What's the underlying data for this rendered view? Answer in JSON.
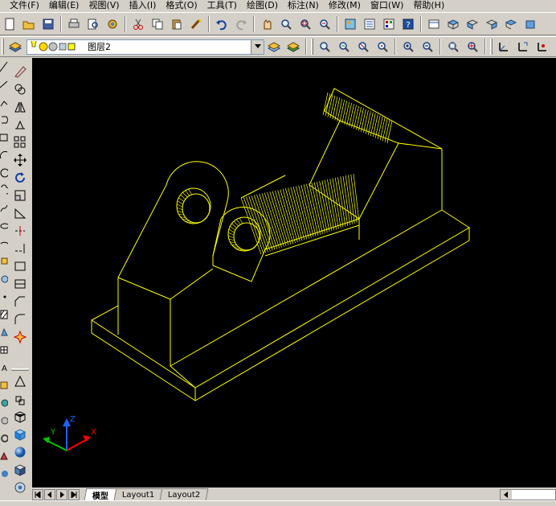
{
  "menu": {
    "items": [
      "文件(F)",
      "编辑(E)",
      "视图(V)",
      "插入(I)",
      "格式(O)",
      "工具(T)",
      "绘图(D)",
      "标注(N)",
      "修改(M)",
      "窗口(W)",
      "帮助(H)"
    ]
  },
  "layer_toolbar": {
    "current_layer": "图层2"
  },
  "viewport": {
    "background": "#000000",
    "line_color": "#ffff00",
    "ucs": {
      "x_label": "X",
      "y_label": "Y",
      "z_label": "Z",
      "x_color": "#ff0000",
      "y_color": "#00c800",
      "z_color": "#2060ff"
    }
  },
  "tabs": {
    "items": [
      "模型",
      "Layout1",
      "Layout2"
    ],
    "active": "模型"
  },
  "icons": {
    "toolbar1": [
      "new-icon",
      "open-icon",
      "save-icon",
      "print-icon",
      "preview-icon",
      "publish-icon",
      "cut-icon",
      "copy-icon",
      "paste-icon",
      "match-properties-icon",
      "undo-icon",
      "redo-icon",
      "pan-icon",
      "zoom-realtime-icon",
      "zoom-window-icon",
      "zoom-previous-icon",
      "design-center-icon",
      "properties-icon",
      "tool-palettes-icon",
      "help-icon"
    ],
    "toolbar2": [
      "layer-manager-icon",
      "make-object-layer-current-icon",
      "layer-previous-icon",
      "zoom-window-icon",
      "zoom-dynamic-icon",
      "zoom-scale-icon",
      "zoom-center-icon",
      "zoom-in-icon",
      "zoom-out-icon",
      "zoom-all-icon",
      "zoom-extents-icon"
    ]
  }
}
